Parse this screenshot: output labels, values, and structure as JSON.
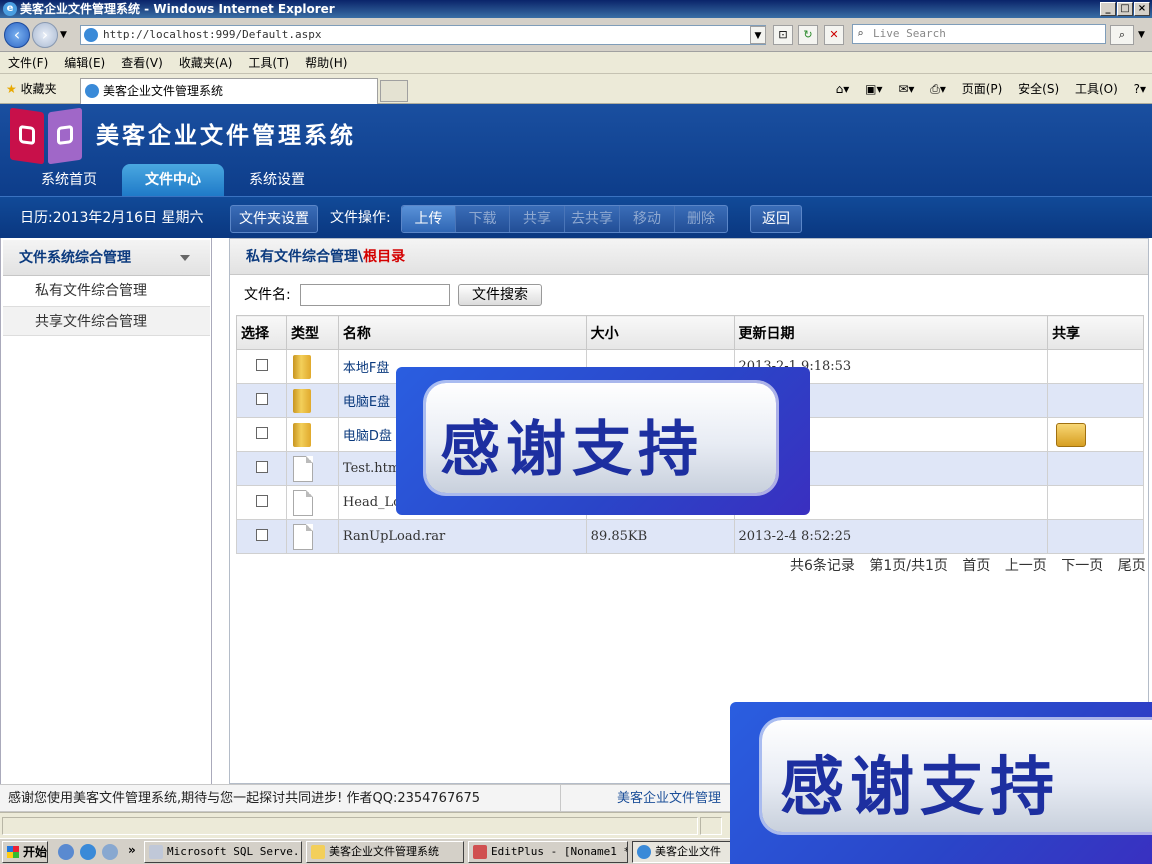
{
  "window": {
    "title": "美客企业文件管理系统 - Windows Internet Explorer"
  },
  "browser": {
    "address": "http://localhost:999/Default.aspx",
    "search_placeholder": "Live Search",
    "menu": [
      "文件(F)",
      "编辑(E)",
      "查看(V)",
      "收藏夹(A)",
      "工具(T)",
      "帮助(H)"
    ],
    "favorites_label": "收藏夹",
    "tab_title": "美客企业文件管理系统",
    "command_bar": [
      "页面(P)",
      "安全(S)",
      "工具(O)"
    ]
  },
  "app": {
    "title": "美客企业文件管理系统",
    "nav_tabs": [
      "系统首页",
      "文件中心",
      "系统设置"
    ],
    "toolbar": {
      "calendar": "日历:2013年2月16日  星期六",
      "folder_settings": "文件夹设置",
      "file_ops_label": "文件操作:",
      "ops": [
        "上传",
        "下载",
        "共享",
        "去共享",
        "移动",
        "删除"
      ],
      "back": "返回"
    },
    "sidebar": {
      "header": "文件系统综合管理",
      "items": [
        "私有文件综合管理",
        "共享文件综合管理"
      ]
    },
    "main": {
      "header_path": "私有文件综合管理",
      "header_sep": "\\",
      "header_current": "根目录",
      "search_label": "文件名:",
      "search_value": "",
      "search_button": "文件搜索",
      "columns": [
        "选择",
        "类型",
        "名称",
        "大小",
        "更新日期",
        "共享"
      ],
      "rows": [
        {
          "name": "本地F盘",
          "size": "",
          "date": "2013-2-1 9:18:53",
          "type": "folder",
          "shared": false
        },
        {
          "name": "电脑E盘",
          "size": "",
          "date": "8:50:05",
          "type": "folder",
          "shared": false
        },
        {
          "name": "电脑D盘",
          "size": "",
          "date": ":48:27",
          "type": "folder",
          "shared": true
        },
        {
          "name": "Test.html",
          "size": "",
          "date": ":56:12",
          "type": "file",
          "shared": false
        },
        {
          "name": "Head_Log",
          "size": "",
          "date": ":53:31",
          "type": "file",
          "shared": false
        },
        {
          "name": "RanUpLoad.rar",
          "size": "89.85KB",
          "date": "2013-2-4 8:52:25",
          "type": "file",
          "shared": false
        }
      ],
      "pager": {
        "total": "共6条记录",
        "page_info": "第1页/共1页",
        "first": "首页",
        "prev": "上一页",
        "next": "下一页",
        "last": "尾页"
      }
    },
    "footer": {
      "left": "感谢您使用美客文件管理系统,期待与您一起探讨共同进步!  作者QQ:2354767675",
      "right": "美客企业文件管理"
    }
  },
  "overlay": {
    "text": "感谢支持"
  },
  "taskbar": {
    "start": "开始",
    "items": [
      "Microsoft SQL Serve...",
      "美客企业文件管理系统",
      "EditPlus - [Noname1 *]",
      "美客企业文件"
    ]
  },
  "colors": {
    "brand_blue": "#0d3d8a",
    "active_tab": "#1f7ac8",
    "link": "#0b3a7e",
    "alt_row": "#dfe6f7",
    "path_red": "#d40000"
  }
}
